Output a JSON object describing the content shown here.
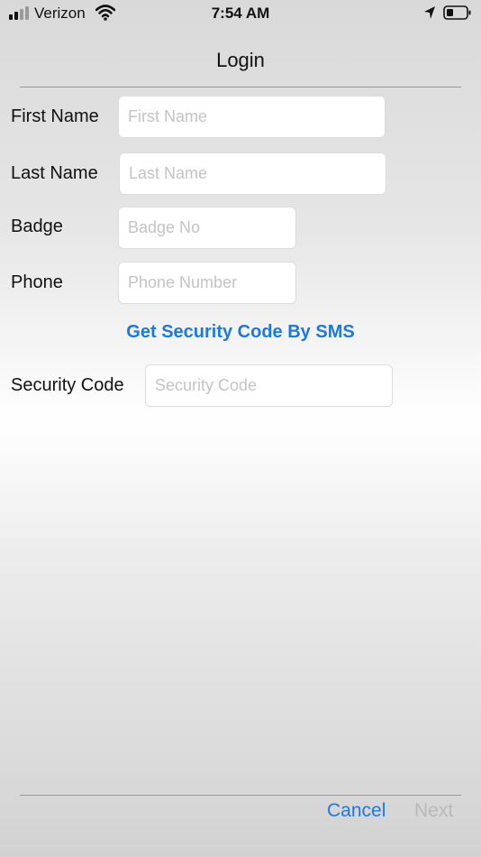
{
  "status_bar": {
    "carrier": "Verizon",
    "time": "7:54 AM",
    "signal_icon": "cellular-signal-icon",
    "wifi_icon": "wifi-icon",
    "location_icon": "location-arrow-icon",
    "battery_icon": "battery-icon"
  },
  "nav": {
    "title": "Login"
  },
  "form": {
    "first_name": {
      "label": "First Name",
      "placeholder": "First Name",
      "value": ""
    },
    "last_name": {
      "label": "Last Name",
      "placeholder": "Last Name",
      "value": ""
    },
    "badge": {
      "label": "Badge",
      "placeholder": "Badge No",
      "value": ""
    },
    "phone": {
      "label": "Phone",
      "placeholder": "Phone Number",
      "value": ""
    },
    "sms_link": "Get Security Code By SMS",
    "security_code": {
      "label": "Security Code",
      "placeholder": "Security Code",
      "value": ""
    }
  },
  "toolbar": {
    "cancel_label": "Cancel",
    "next_label": "Next"
  },
  "colors": {
    "accent": "#1a7ae0",
    "disabled": "#b9b9b9",
    "placeholder": "#c4c4c4"
  }
}
